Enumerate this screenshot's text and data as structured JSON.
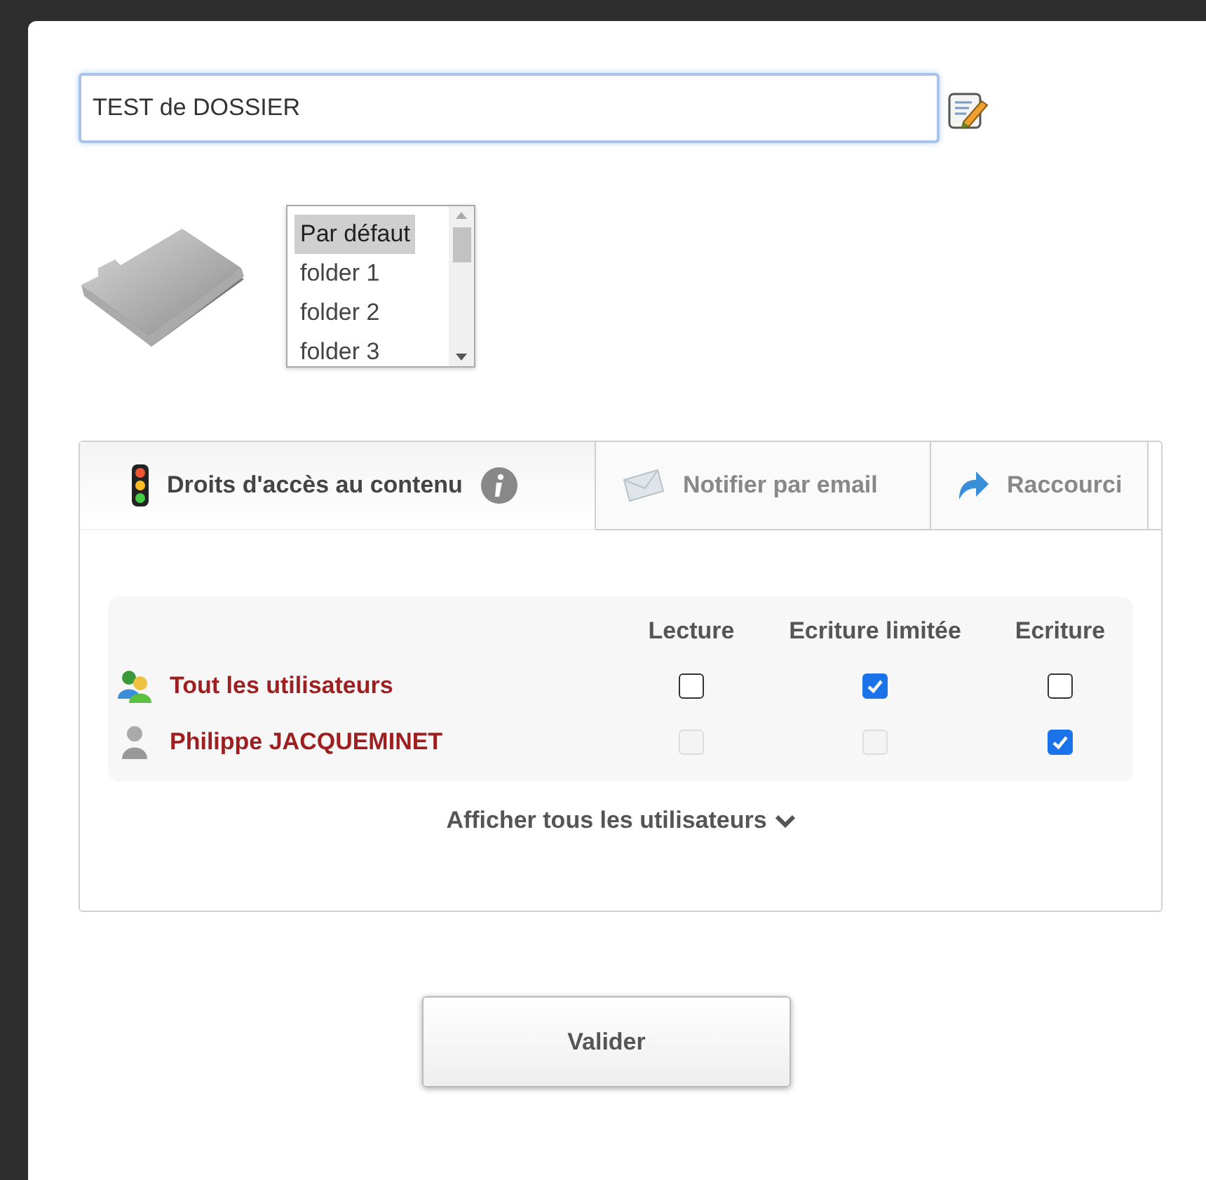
{
  "name_field": {
    "value": "TEST de DOSSIER"
  },
  "folder_list": {
    "items": [
      {
        "label": "Par défaut",
        "selected": true
      },
      {
        "label": "folder 1",
        "selected": false
      },
      {
        "label": "folder 2",
        "selected": false
      },
      {
        "label": "folder 3",
        "selected": false
      }
    ]
  },
  "tabs": [
    {
      "label": "Droits d'accès au contenu",
      "kind": "rights",
      "selected": true
    },
    {
      "label": "Notifier par email",
      "kind": "email",
      "selected": false
    },
    {
      "label": "Raccourci",
      "kind": "shortcut",
      "selected": false
    }
  ],
  "rights_table": {
    "columns": [
      "Lecture",
      "Ecriture limitée",
      "Ecriture"
    ],
    "rows": [
      {
        "name": "Tout les utilisateurs",
        "kind": "group",
        "cells": [
          {
            "checked": false,
            "disabled": false
          },
          {
            "checked": true,
            "disabled": false
          },
          {
            "checked": false,
            "disabled": false
          }
        ]
      },
      {
        "name": "Philippe JACQUEMINET",
        "kind": "user",
        "cells": [
          {
            "checked": false,
            "disabled": true
          },
          {
            "checked": false,
            "disabled": true
          },
          {
            "checked": true,
            "disabled": false
          }
        ]
      }
    ]
  },
  "show_all_link": "Afficher tous les utilisateurs",
  "submit_button": "Valider"
}
